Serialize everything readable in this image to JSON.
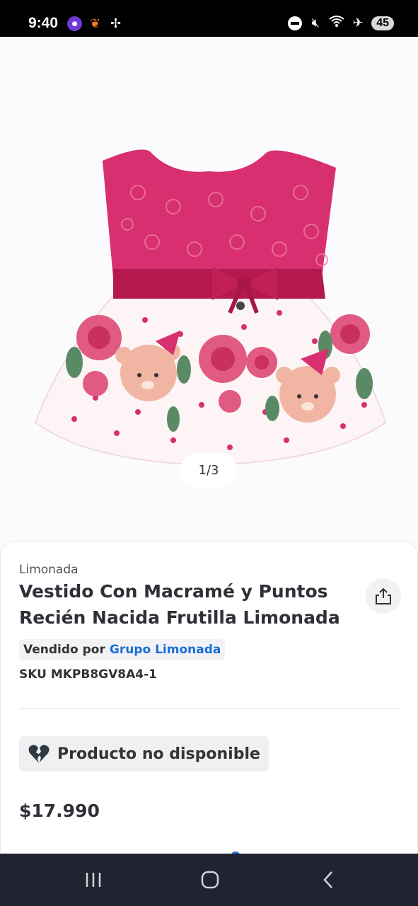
{
  "status_bar": {
    "time": "9:40",
    "notification_icons": [
      "messenger-icon",
      "loyalty-icon",
      "pinwheel-icon"
    ],
    "system_icons": [
      "do-not-disturb-icon",
      "mute-icon",
      "wifi-icon",
      "airplane-icon"
    ],
    "battery": "45"
  },
  "gallery": {
    "page_indicator": "1/3"
  },
  "product": {
    "brand": "Limonada",
    "title": "Vestido Con Macramé y Puntos Recién Nacida Frutilla Limonada",
    "seller_prefix": "Vendido por",
    "seller_name": "Grupo Limonada",
    "sku": "SKU MKPB8GV8A4-1",
    "availability": "Producto no disponible",
    "price": "$17.990"
  },
  "colors": {
    "accent_blue": "#1a6fd6",
    "dress_pink": "#d72f6f",
    "text_dark": "#2f2f38"
  },
  "nav_bar": {
    "buttons": [
      "recent-apps",
      "home",
      "back"
    ]
  }
}
